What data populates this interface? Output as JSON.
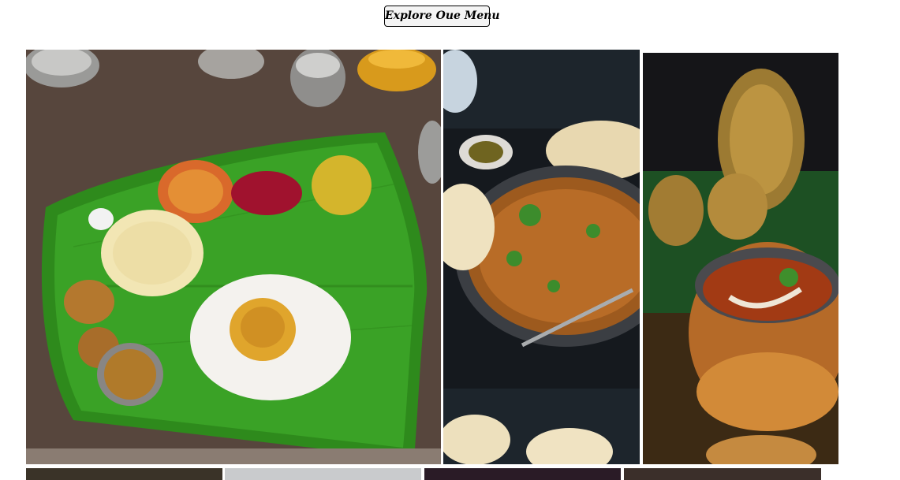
{
  "header": {
    "menu_button_label": "Explore Oue Menu"
  },
  "gallery": {
    "images": [
      {
        "name": "banana-leaf-thali-photo"
      },
      {
        "name": "curry-with-naan-photo"
      },
      {
        "name": "copper-pot-curry-photo"
      },
      {
        "name": "gallery-photo-4"
      },
      {
        "name": "gallery-photo-5"
      },
      {
        "name": "gallery-photo-6"
      },
      {
        "name": "gallery-photo-7"
      }
    ]
  }
}
